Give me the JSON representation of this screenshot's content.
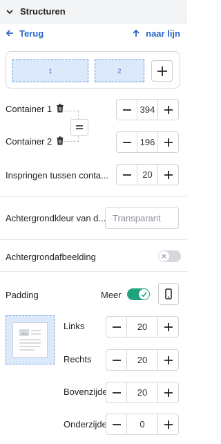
{
  "header": {
    "title": "Structuren",
    "chevron_icon": "chevron-down-icon"
  },
  "nav": {
    "back_label": "Terug",
    "up_label": "naar lijn"
  },
  "columns": {
    "items": [
      "1",
      "2"
    ],
    "add_icon": "plus-icon"
  },
  "containers": [
    {
      "label": "Container 1",
      "value": "394"
    },
    {
      "label": "Container 2",
      "value": "196"
    }
  ],
  "indent": {
    "label": "Inspringen tussen conta...",
    "value": "20"
  },
  "background_color": {
    "label": "Achtergrondkleur van d...",
    "placeholder": "Transparant"
  },
  "background_image": {
    "label": "Achtergrondafbeelding",
    "enabled": false
  },
  "padding": {
    "label": "Padding",
    "more_label": "Meer",
    "more_enabled": true,
    "fields": [
      {
        "label": "Links",
        "value": "20"
      },
      {
        "label": "Rechts",
        "value": "20"
      },
      {
        "label": "Bovenzijde",
        "value": "20"
      },
      {
        "label": "Onderzijde",
        "value": "0"
      }
    ]
  },
  "colors": {
    "accent": "#2a64c8",
    "toggle_on": "#1fa37e",
    "column_fill": "#dce9fb"
  }
}
